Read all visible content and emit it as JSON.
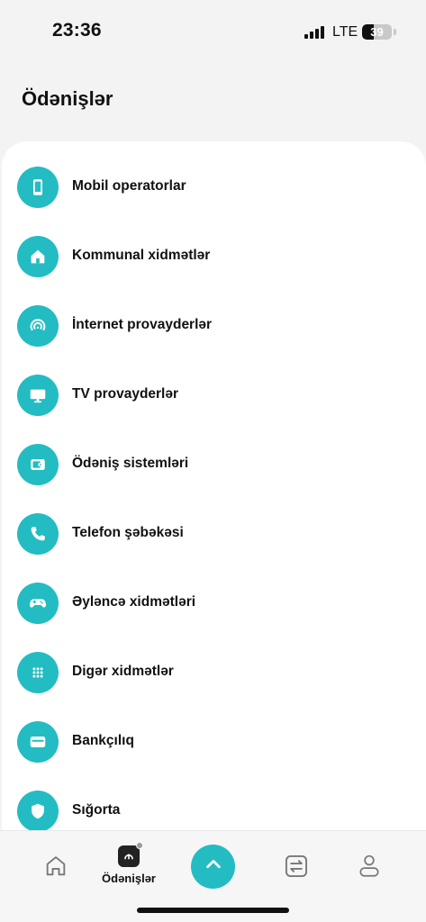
{
  "status_bar": {
    "time": "23:36",
    "network": "LTE",
    "battery": "39",
    "battery_level": 0.39
  },
  "page": {
    "title": "Ödənişlər"
  },
  "colors": {
    "accent": "#23bcc2",
    "background": "#f3f3f3",
    "card": "#ffffff"
  },
  "menu": {
    "items": [
      {
        "label": "Mobil operatorlar",
        "icon": "mobile-phone-icon"
      },
      {
        "label": "Kommunal xidmətlər",
        "icon": "home-icon"
      },
      {
        "label": "İnternet provayderlər",
        "icon": "wifi-signal-icon"
      },
      {
        "label": "TV provayderlər",
        "icon": "tv-monitor-icon"
      },
      {
        "label": "Ödəniş sistemləri",
        "icon": "wallet-icon"
      },
      {
        "label": "Telefon şəbəkəsi",
        "icon": "phone-icon"
      },
      {
        "label": "Əyləncə xidmətləri",
        "icon": "gamepad-icon"
      },
      {
        "label": "Digər xidmətlər",
        "icon": "dots-grid-icon"
      },
      {
        "label": "Bankçılıq",
        "icon": "card-icon"
      },
      {
        "label": "Sığorta",
        "icon": "shield-icon"
      }
    ]
  },
  "bottom_nav": {
    "home_icon": "home-outline-icon",
    "payments_label": "Ödənişlər",
    "payments_icon": "payments-icon",
    "center_icon": "chevron-up-icon",
    "transfers_icon": "transfer-arrows-icon",
    "profile_icon": "user-icon"
  }
}
